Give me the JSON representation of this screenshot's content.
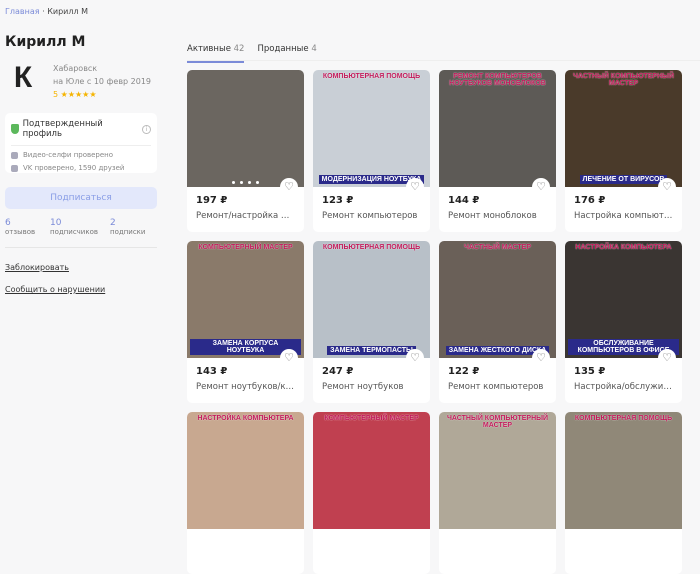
{
  "breadcrumb": {
    "home": "Главная",
    "sep": "·",
    "current": "Кирилл М"
  },
  "profile": {
    "name": "Кирилл М",
    "avatar_letter": "К",
    "city": "Хабаровск",
    "since": "на Юле с 10 февр 2019",
    "rating": "5",
    "stars": "★★★★★"
  },
  "verification": {
    "title": "Подтвержденный профиль",
    "info": "i",
    "video": "Видео-селфи проверено",
    "vk": "VK проверено, 1590 друзей"
  },
  "subscribe_label": "Подписаться",
  "stats": [
    {
      "value": "6",
      "label": "отзывов"
    },
    {
      "value": "10",
      "label": "подписчиков"
    },
    {
      "value": "2",
      "label": "подписки"
    }
  ],
  "links": {
    "block": "Заблокировать",
    "report": "Сообщить о нарушении"
  },
  "tabs": [
    {
      "label": "Активные",
      "count": "42"
    },
    {
      "label": "Проданные",
      "count": "4"
    }
  ],
  "heart": "♡",
  "products": [
    {
      "price": "197 ₽",
      "title": "Ремонт/настройка м...",
      "cap1": "",
      "cap2": "",
      "bg": "#6b6660"
    },
    {
      "price": "123 ₽",
      "title": "Ремонт компьютеров",
      "cap1": "КОМПЬЮТЕРНАЯ ПОМОЩЬ",
      "cap2": "МОДЕРНИЗАЦИЯ НОУТБУКА",
      "bg": "#c9cfd6"
    },
    {
      "price": "144 ₽",
      "title": "Ремонт моноблоков",
      "cap1": "РЕМОНТ КОМПЬЮТЕРОВ НОУТБУКОВ МОНОБЛОКОВ",
      "cap2": "",
      "bg": "#5d5a56"
    },
    {
      "price": "176 ₽",
      "title": "Настройка компьюте...",
      "cap1": "ЧАСТНЫЙ КОМПЬЮТЕРНЫЙ МАСТЕР",
      "cap2": "ЛЕЧЕНИЕ ОТ ВИРУСОВ",
      "bg": "#4a3a2a"
    },
    {
      "price": "143 ₽",
      "title": "Ремонт ноутбуков/ко...",
      "cap1": "КОМПЬЮТЕРНЫЙ МАСТЕР",
      "cap2": "ЗАМЕНА КОРПУСА НОУТБУКА",
      "bg": "#8a7a6a"
    },
    {
      "price": "247 ₽",
      "title": "Ремонт ноутбуков",
      "cap1": "КОМПЬЮТЕРНАЯ ПОМОЩЬ",
      "cap2": "ЗАМЕНА ТЕРМОПАСТЫ",
      "bg": "#b8c0c8"
    },
    {
      "price": "122 ₽",
      "title": "Ремонт компьютеров",
      "cap1": "ЧАСТНЫЙ МАСТЕР",
      "cap2": "ЗАМЕНА ЖЕСТКОГО ДИСКА",
      "bg": "#6a6058"
    },
    {
      "price": "135 ₽",
      "title": "Настройка/обслужив...",
      "cap1": "НАСТРОЙКА КОМПЬЮТЕРА",
      "cap2": "ОБСЛУЖИВАНИЕ КОМПЬЮТЕРОВ В ОФИСЕ",
      "bg": "#3a3532"
    },
    {
      "price": "",
      "title": "",
      "cap1": "НАСТРОЙКА КОМПЬЮТЕРА",
      "cap2": "",
      "bg": "#c8a890"
    },
    {
      "price": "",
      "title": "",
      "cap1": "КОМПЬЮТЕРНЫЙ МАСТЕР",
      "cap2": "",
      "bg": "#c04050"
    },
    {
      "price": "",
      "title": "",
      "cap1": "ЧАСТНЫЙ КОМПЬЮТЕРНЫЙ МАСТЕР",
      "cap2": "",
      "bg": "#b0a898"
    },
    {
      "price": "",
      "title": "",
      "cap1": "КОМПЬЮТЕРНАЯ ПОМОЩЬ",
      "cap2": "",
      "bg": "#908878"
    }
  ]
}
